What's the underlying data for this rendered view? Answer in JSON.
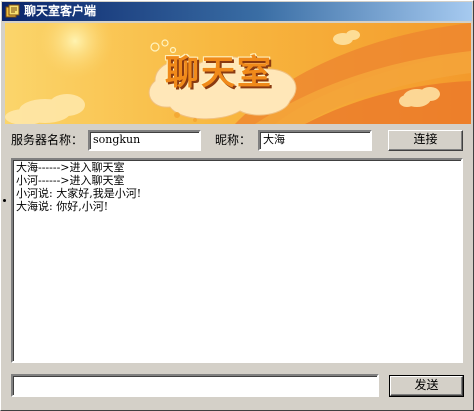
{
  "window": {
    "title": "聊天室客户端"
  },
  "banner": {
    "logo_text": "聊天室",
    "colors": {
      "primary": "#f4a530",
      "light": "#fbd56b",
      "deep": "#e9742a"
    }
  },
  "connection": {
    "server_label": "服务器名称：",
    "server_value": "songkun",
    "nick_label": "昵称：",
    "nick_value": "大海",
    "connect_label": "连接"
  },
  "chat": {
    "messages": [
      "大海------>进入聊天室",
      "小河------>进入聊天室",
      "小河说: 大家好,我是小河!",
      "大海说: 你好,小河!"
    ]
  },
  "compose": {
    "input_value": "",
    "send_label": "发送"
  },
  "icons": {
    "title_icon": "app-icon"
  }
}
